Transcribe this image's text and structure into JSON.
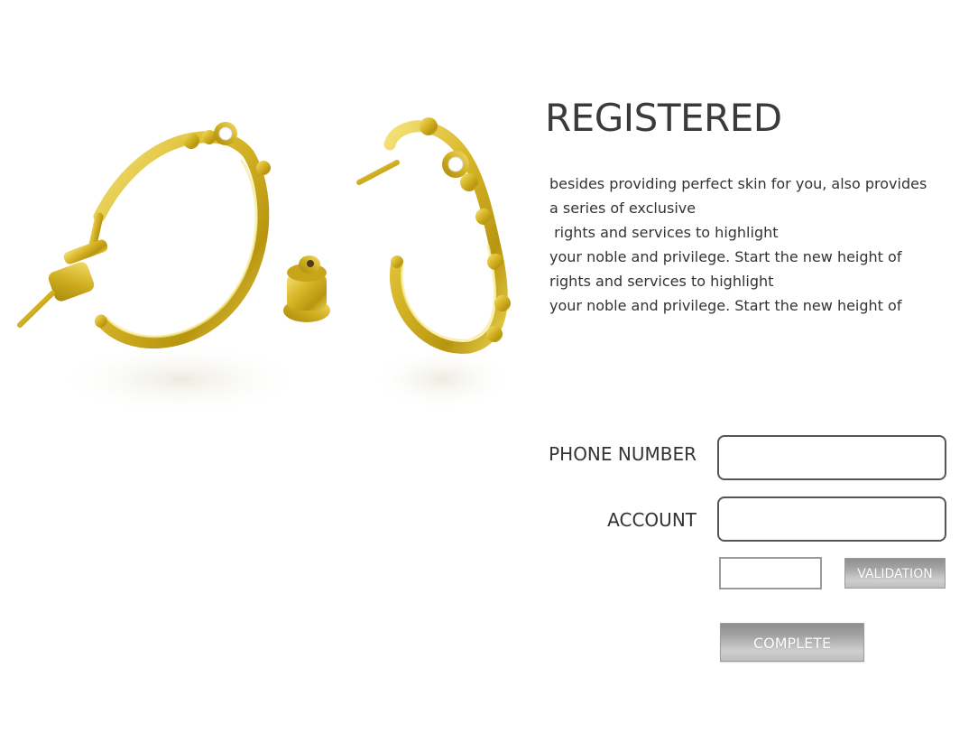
{
  "page": {
    "title": "REGISTERED",
    "description_lines": [
      "besides providing perfect skin for you, also provides",
      "a series of exclusive",
      " rights and services to highlight",
      "your noble and privilege. Start the new height of",
      "rights and services to highlight",
      "your noble and privilege. Start the new height of"
    ]
  },
  "form": {
    "phone_label": "PHONE NUMBER",
    "phone_value": "",
    "account_label": "ACCOUNT",
    "account_value": "",
    "code_value": "",
    "validation_button": "VALIDATION",
    "complete_button": "COMPLETE"
  },
  "colors": {
    "gold": "#d4b52a",
    "gold_dark": "#9c7f10",
    "gold_light": "#f3e27a",
    "text": "#333333",
    "button_gray": "#a8a8a8"
  },
  "image": {
    "subject": "gold-hoop-earrings"
  }
}
